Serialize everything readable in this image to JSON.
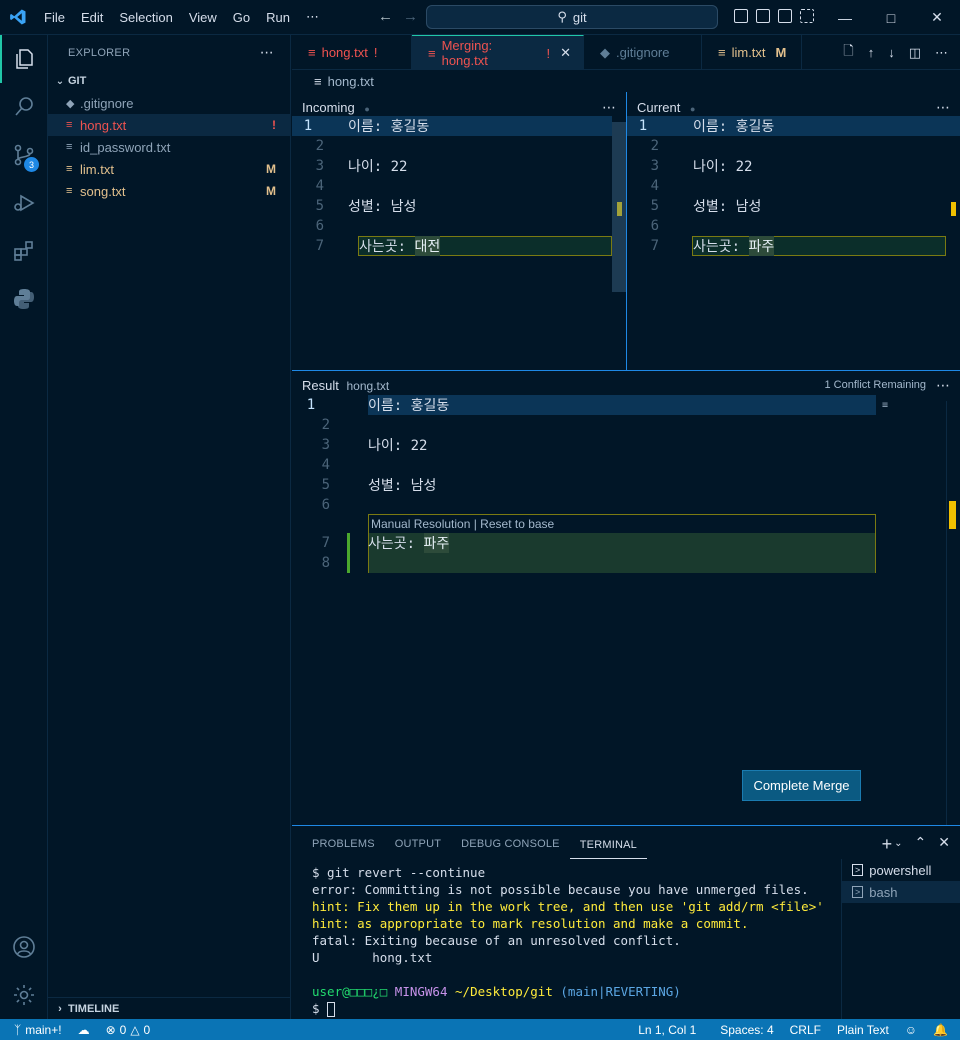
{
  "titlebar": {
    "menu": [
      "File",
      "Edit",
      "Selection",
      "View",
      "Go",
      "Run",
      "⋯"
    ],
    "search": "git"
  },
  "activity": {
    "source_control_badge": "3"
  },
  "sidebar": {
    "title": "EXPLORER",
    "section": "GIT",
    "files": [
      {
        "name": ".gitignore",
        "status": "",
        "color": "#8fa4b8"
      },
      {
        "name": "hong.txt",
        "status": "!",
        "color": "#ef5350"
      },
      {
        "name": "id_password.txt",
        "status": "",
        "color": "#8fa4b8"
      },
      {
        "name": "lim.txt",
        "status": "M",
        "color": "#e2c08d"
      },
      {
        "name": "song.txt",
        "status": "M",
        "color": "#e2c08d"
      }
    ],
    "timeline": "TIMELINE"
  },
  "tabs": [
    {
      "label": "hong.txt",
      "mark": "!",
      "color": "#ef5350"
    },
    {
      "label": "Merging: hong.txt",
      "mark": "!",
      "color": "#ef5350",
      "close": "✕"
    },
    {
      "label": ".gitignore",
      "mark": "",
      "color": "#5f7e97"
    },
    {
      "label": "lim.txt",
      "mark": "M",
      "color": "#e2c08d"
    }
  ],
  "breadcrumb": "hong.txt",
  "incoming": {
    "title": "Incoming",
    "lines": [
      {
        "n": "1",
        "t": "이름: 홍길동"
      },
      {
        "n": "2",
        "t": ""
      },
      {
        "n": "3",
        "t": "나이: 22"
      },
      {
        "n": "4",
        "t": ""
      },
      {
        "n": "5",
        "t": "성별: 남성"
      },
      {
        "n": "6",
        "t": ""
      },
      {
        "n": "7",
        "t": "사는곳: ",
        "hl": "대전"
      }
    ]
  },
  "current": {
    "title": "Current",
    "lines": [
      {
        "n": "1",
        "t": "이름: 홍길동"
      },
      {
        "n": "2",
        "t": ""
      },
      {
        "n": "3",
        "t": "나이: 22"
      },
      {
        "n": "4",
        "t": ""
      },
      {
        "n": "5",
        "t": "성별: 남성"
      },
      {
        "n": "6",
        "t": ""
      },
      {
        "n": "7",
        "t": "사는곳: ",
        "hl": "파주"
      }
    ]
  },
  "result": {
    "title": "Result",
    "file": "hong.txt",
    "conflicts": "1 Conflict Remaining",
    "codelens": "Manual Resolution | Reset to base",
    "lines": [
      {
        "n": "1",
        "t": "이름: 홍길동"
      },
      {
        "n": "2",
        "t": ""
      },
      {
        "n": "3",
        "t": "나이: 22"
      },
      {
        "n": "4",
        "t": ""
      },
      {
        "n": "5",
        "t": "성별: 남성"
      },
      {
        "n": "6",
        "t": ""
      },
      {
        "n": "7",
        "t": "사는곳: ",
        "hl": "파주"
      },
      {
        "n": "8",
        "t": ""
      }
    ],
    "complete": "Complete Merge"
  },
  "panel": {
    "tabs": [
      "PROBLEMS",
      "OUTPUT",
      "DEBUG CONSOLE",
      "TERMINAL"
    ],
    "terminal": [
      {
        "t": "$ git revert --continue",
        "c": "#d6deeb"
      },
      {
        "t": "error: Committing is not possible because you have unmerged files.",
        "c": "#d6deeb"
      },
      {
        "t": "hint: Fix them up in the work tree, and then use 'git add/rm <file>'",
        "c": "#ffeb3b"
      },
      {
        "t": "hint: as appropriate to mark resolution and make a commit.",
        "c": "#ffeb3b"
      },
      {
        "t": "fatal: Exiting because of an unresolved conflict.",
        "c": "#d6deeb"
      },
      {
        "t": "U       hong.txt",
        "c": "#d6deeb"
      },
      {
        "t": "",
        "c": "#d6deeb"
      }
    ],
    "prompt_user": "user@□□□¿□",
    "prompt_host": "MINGW64",
    "prompt_path": "~/Desktop/git",
    "prompt_branch": "(main|REVERTING)",
    "prompt": "$",
    "shells": [
      "powershell",
      "bash"
    ]
  },
  "status": {
    "branch": "main+!",
    "errors": "0",
    "warnings": "0",
    "position": "Ln 1, Col 1",
    "spaces": "Spaces: 4",
    "eol": "CRLF",
    "language": "Plain Text"
  }
}
